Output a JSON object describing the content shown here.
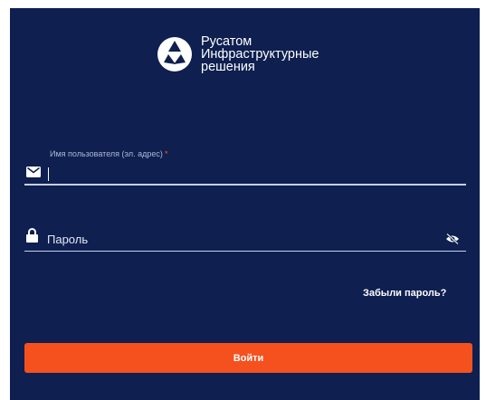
{
  "brand": {
    "line1": "Русатом",
    "line2": "Инфраструктурные",
    "line3": "решения"
  },
  "form": {
    "username_label": "Имя пользователя (эл. адрес)",
    "required_mark": "*",
    "username_value": "",
    "password_placeholder": "Пароль",
    "forgot_link": "Забыли пароль?",
    "submit_label": "Войти"
  },
  "icons": {
    "logo": "rosatom-logo",
    "username": "envelope-icon",
    "password": "lock-icon",
    "visibility": "eye-slash-icon"
  },
  "colors": {
    "panel_background": "#0e1f50",
    "accent": "#f4511e",
    "required": "#ff5a2a",
    "label": "#aeb8d8"
  }
}
